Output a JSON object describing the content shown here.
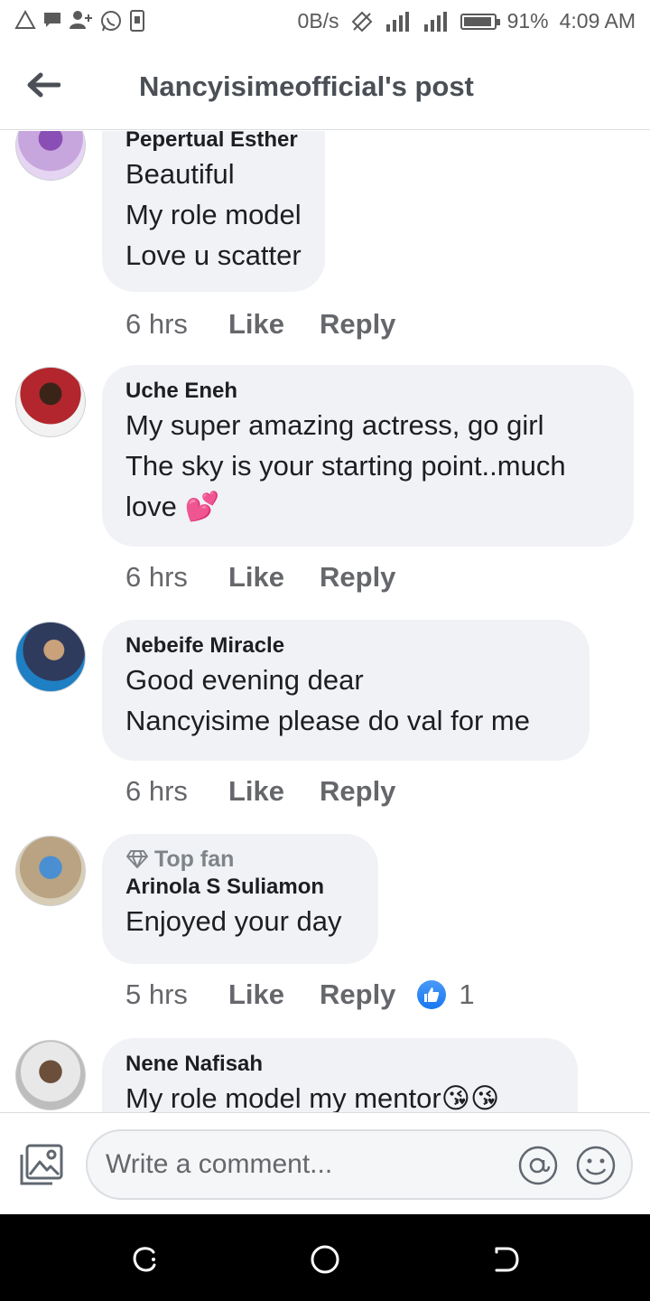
{
  "status_bar": {
    "net_speed": "0B/s",
    "battery": "91%",
    "time": "4:09 AM"
  },
  "header": {
    "title": "Nancyisimeofficial's post"
  },
  "comments": [
    {
      "author": "Pepertual Esther",
      "lines": [
        "Beautiful",
        "My role model",
        "Love u scatter"
      ],
      "time": "6 hrs",
      "like_label": "Like",
      "reply_label": "Reply"
    },
    {
      "author": "Uche Eneh",
      "lines": [
        "My super amazing actress, go girl",
        "The sky is your starting point..much",
        "love 💕"
      ],
      "time": "6 hrs",
      "like_label": "Like",
      "reply_label": "Reply"
    },
    {
      "author": "Nebeife Miracle",
      "lines": [
        "Good evening dear",
        "Nancyisime please do val for me"
      ],
      "time": "6 hrs",
      "like_label": "Like",
      "reply_label": "Reply"
    },
    {
      "badge": "Top fan",
      "author": "Arinola S Suliamon",
      "lines": [
        "Enjoyed your day"
      ],
      "time": "5 hrs",
      "like_label": "Like",
      "reply_label": "Reply",
      "reaction_count": "1"
    },
    {
      "author": "Nene Nafisah",
      "lines": [
        "My role model my mentor😘😘"
      ]
    }
  ],
  "composer": {
    "placeholder": "Write a comment..."
  },
  "icons": {
    "back": "arrow-left-icon",
    "photo": "photo-icon",
    "mention": "at-sign-icon",
    "emoji": "smiley-icon",
    "top_fan": "diamond-icon",
    "like_reaction": "thumbs-up-icon"
  },
  "colors": {
    "bubble": "#f0f2f5",
    "text": "#1c1e21",
    "meta": "#65676b",
    "like_blue": "#1877f2"
  }
}
